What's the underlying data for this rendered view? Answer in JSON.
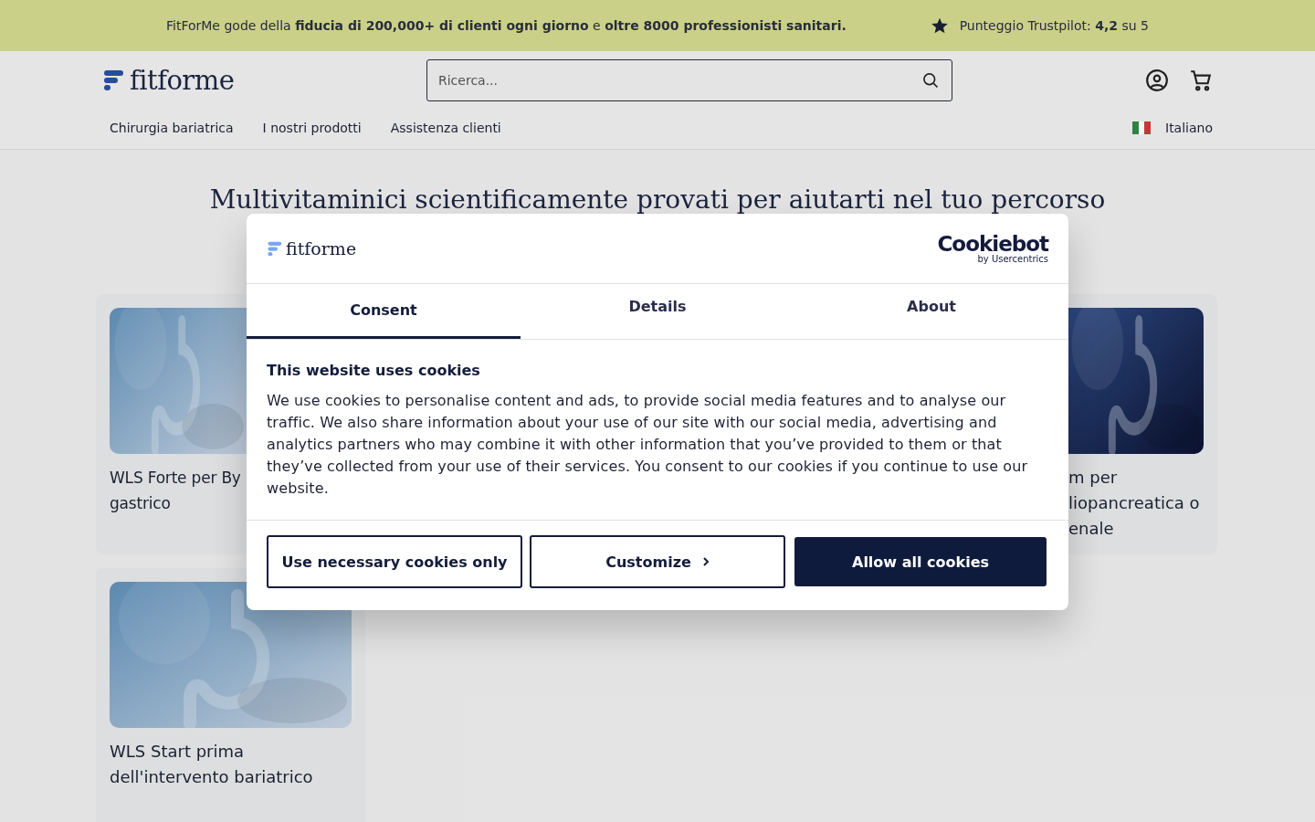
{
  "promo_bar": {
    "message": "FitForMe gode della **fiducia di 200,000+ di clienti ogni giorno** e **oltre 8000 professionisti sanitari.**",
    "rating": "Punteggio Trustpilot: **4,2** su 5"
  },
  "header": {
    "logo": "fitforme",
    "search": {
      "placeholder": "Ricerca..."
    },
    "nav": [
      "Chirurgia bariatrica",
      "I nostri prodotti",
      "Assistenza clienti"
    ],
    "language": "Italiano"
  },
  "main": {
    "heading": "Multivitaminici scientificamente provati per aiutarti nel tuo percorso",
    "products": [
      {
        "kind": "cut_right",
        "title_lines": [
          "WLS Forte per By",
          "gastrico"
        ]
      },
      {
        "kind": "cut_left",
        "title_lines": [
          "m per",
          "liopancreatica o",
          "enale"
        ]
      },
      {
        "kind": "whole",
        "title_lines": [
          "WLS Start prima",
          "dell'intervento bariatrico"
        ]
      }
    ]
  },
  "cookie_dialog": {
    "logo": "fitforme",
    "provider": "Cookiebot",
    "provider_note": "by Usercentrics",
    "tabs": [
      {
        "label": "Consent",
        "selected": true
      },
      {
        "label": "Details",
        "selected": false
      },
      {
        "label": "About",
        "selected": false
      }
    ],
    "heading": "This website uses cookies",
    "body": "We use cookies to personalise content and ads, to provide social media features and to analyse our traffic. We also share information about your use of our site with our social media, advertising and analytics partners who may combine it with other information that you’ve provided to them or that they’ve collected from your use of their services. You consent to our cookies if you continue to use our website.",
    "buttons": [
      {
        "label": "Use necessary cookies only",
        "kind": "outline"
      },
      {
        "label": "Customize",
        "kind": "chevron"
      },
      {
        "label": "Allow all cookies",
        "kind": "primary"
      }
    ]
  }
}
